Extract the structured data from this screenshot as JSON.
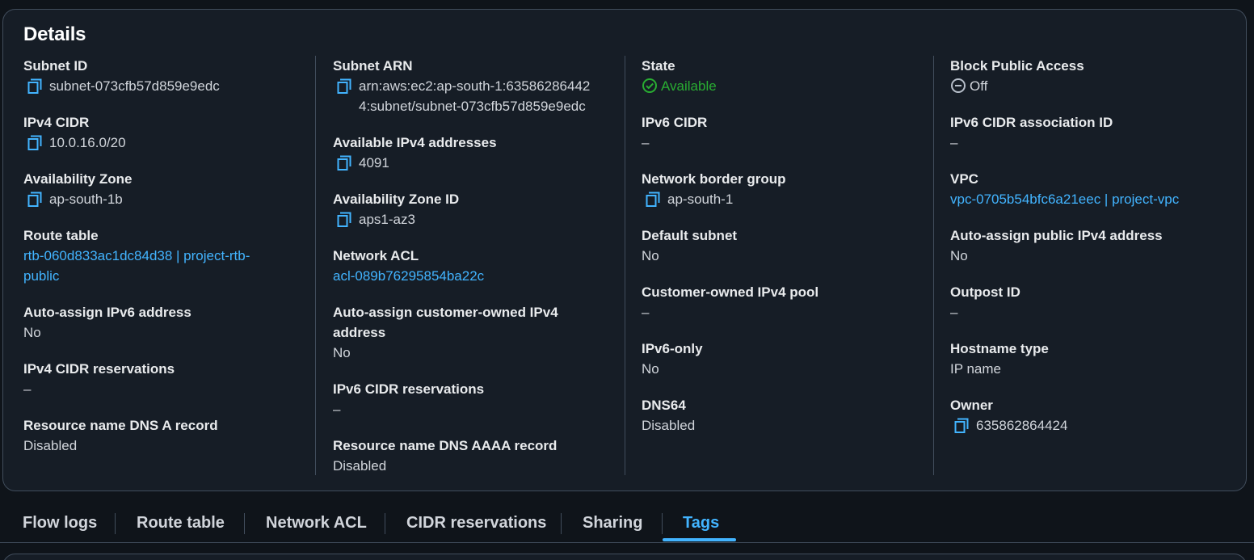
{
  "details": {
    "title": "Details",
    "columns": [
      [
        {
          "label": "Subnet ID",
          "lines": [
            "subnet-073cfb57d859e9edc"
          ],
          "copy": true
        },
        {
          "label": "IPv4 CIDR",
          "lines": [
            "10.0.16.0/20"
          ],
          "copy": true
        },
        {
          "label": "Availability Zone",
          "lines": [
            "ap-south-1b"
          ],
          "copy": true
        },
        {
          "label": "Route table",
          "lines": [
            "rtb-060d833ac1dc84d38 | project-rtb-",
            "public"
          ],
          "link": true
        },
        {
          "label": "Auto-assign IPv6 address",
          "lines": [
            "No"
          ]
        },
        {
          "label": "IPv4 CIDR reservations",
          "lines": [
            "–"
          ]
        },
        {
          "label": "Resource name DNS A record",
          "lines": [
            "Disabled"
          ]
        }
      ],
      [
        {
          "label": "Subnet ARN",
          "lines": [
            "arn:aws:ec2:ap-south-1:63586286442",
            "4:subnet/subnet-073cfb57d859e9edc"
          ],
          "copy": true
        },
        {
          "label": "Available IPv4 addresses",
          "lines": [
            "4091"
          ],
          "copy": true
        },
        {
          "label": "Availability Zone ID",
          "lines": [
            "aps1-az3"
          ],
          "copy": true
        },
        {
          "label": "Network ACL",
          "lines": [
            "acl-089b76295854ba22c"
          ],
          "link": true
        },
        {
          "label": "Auto-assign customer-owned IPv4 address",
          "lines": [
            "No"
          ]
        },
        {
          "label": "IPv6 CIDR reservations",
          "lines": [
            "–"
          ]
        },
        {
          "label": "Resource name DNS AAAA record",
          "lines": [
            "Disabled"
          ]
        }
      ],
      [
        {
          "label": "State",
          "lines": [
            "Available"
          ],
          "status": "available"
        },
        {
          "label": "IPv6 CIDR",
          "lines": [
            "–"
          ]
        },
        {
          "label": "Network border group",
          "lines": [
            "ap-south-1"
          ],
          "copy": true
        },
        {
          "label": "Default subnet",
          "lines": [
            "No"
          ]
        },
        {
          "label": "Customer-owned IPv4 pool",
          "lines": [
            "–"
          ]
        },
        {
          "label": "IPv6-only",
          "lines": [
            "No"
          ]
        },
        {
          "label": "DNS64",
          "lines": [
            "Disabled"
          ]
        }
      ],
      [
        {
          "label": "Block Public Access",
          "lines": [
            "Off"
          ],
          "status": "off"
        },
        {
          "label": "IPv6 CIDR association ID",
          "lines": [
            "–"
          ]
        },
        {
          "label": "VPC",
          "lines": [
            "vpc-0705b54bfc6a21eec | project-vpc"
          ],
          "link": true
        },
        {
          "label": "Auto-assign public IPv4 address",
          "lines": [
            "No"
          ]
        },
        {
          "label": "Outpost ID",
          "lines": [
            "–"
          ]
        },
        {
          "label": "Hostname type",
          "lines": [
            "IP name"
          ]
        },
        {
          "label": "Owner",
          "lines": [
            "635862864424"
          ],
          "copy": true
        }
      ]
    ]
  },
  "tabs": [
    {
      "label": "Flow logs",
      "active": false
    },
    {
      "label": "Route table",
      "active": false
    },
    {
      "label": "Network ACL",
      "active": false
    },
    {
      "label": "CIDR reservations",
      "active": false
    },
    {
      "label": "Sharing",
      "active": false
    },
    {
      "label": "Tags",
      "active": true
    }
  ],
  "colors": {
    "background": "#0f141a",
    "panel": "#161d26",
    "border": "#414d5c",
    "link": "#42b4ff",
    "available": "#29ad32",
    "text": "#d1d5db",
    "heading": "#ffffff"
  }
}
